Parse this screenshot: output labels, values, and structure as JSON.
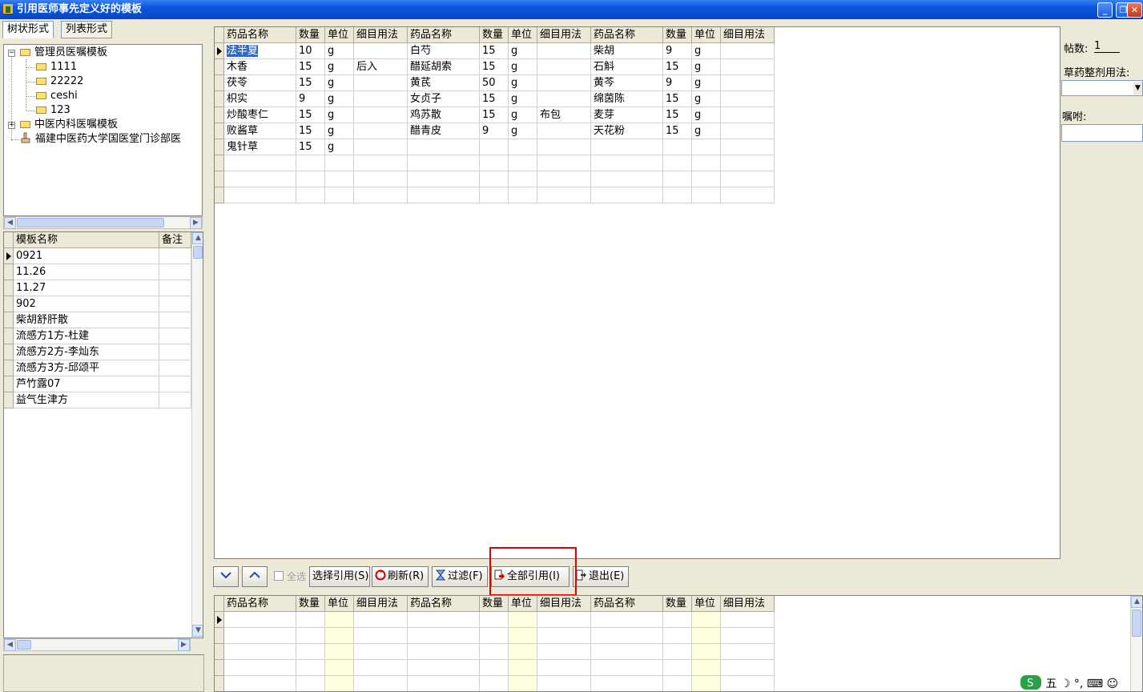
{
  "window": {
    "title": "引用医师事先定义好的模板",
    "min": "_",
    "restore": "❐",
    "close": "✕"
  },
  "tabs": [
    "树状形式",
    "列表形式"
  ],
  "tree": {
    "nodes": [
      {
        "label": "管理员医嘱模板",
        "expanded": true,
        "children": [
          "1111",
          "22222",
          "ceshi",
          "123"
        ]
      },
      {
        "label": "中医内科医嘱模板",
        "expanded": false
      },
      {
        "label": "福建中医药大学国医堂门诊部医"
      }
    ]
  },
  "template_list": {
    "headers": [
      "模板名称",
      "备注"
    ],
    "rows": [
      "0921",
      "11.26",
      "11.27",
      "902",
      "柴胡舒肝散",
      "流感方1方-杜建",
      "流感方2方-李灿东",
      "流感方3方-邱颂平",
      "芦竹露07",
      "益气生津方"
    ]
  },
  "prescription": {
    "headers": [
      "药品名称",
      "数量",
      "单位",
      "细目用法",
      "药品名称",
      "数量",
      "单位",
      "细目用法",
      "药品名称",
      "数量",
      "单位",
      "细目用法"
    ],
    "rows": [
      [
        "法半夏",
        "10",
        "g",
        "",
        "白芍",
        "15",
        "g",
        "",
        "柴胡",
        "9",
        "g",
        ""
      ],
      [
        "木香",
        "15",
        "g",
        "后入",
        "醋延胡索",
        "15",
        "g",
        "",
        "石斛",
        "15",
        "g",
        ""
      ],
      [
        "茯苓",
        "15",
        "g",
        "",
        "黄芪",
        "50",
        "g",
        "",
        "黄芩",
        "9",
        "g",
        ""
      ],
      [
        "枳实",
        "9",
        "g",
        "",
        "女贞子",
        "15",
        "g",
        "",
        "绵茵陈",
        "15",
        "g",
        ""
      ],
      [
        "炒酸枣仁",
        "15",
        "g",
        "",
        "鸡苏散",
        "15",
        "g",
        "布包",
        "麦芽",
        "15",
        "g",
        ""
      ],
      [
        "败酱草",
        "15",
        "g",
        "",
        "醋青皮",
        "9",
        "g",
        "",
        "天花粉",
        "15",
        "g",
        ""
      ],
      [
        "鬼针草",
        "15",
        "g",
        "",
        "",
        "",
        "",
        "",
        "",
        "",
        "",
        ""
      ]
    ]
  },
  "toolbar": {
    "select_all": "全选",
    "select_ref": "选择引用(S)",
    "refresh": "刷新(R)",
    "filter": "过滤(F)",
    "ref_all": "全部引用(I)",
    "exit": "退出(E)"
  },
  "right_panel": {
    "tie_label": "帖数:",
    "tie_value": "1",
    "decoction_label": "草药整剂用法:",
    "advice_label": "嘱咐:"
  },
  "ime": {
    "mode": "五"
  },
  "colors": {
    "title_bar": "#0a54de",
    "selection": "#316ac5",
    "highlight_box": "#e00000",
    "unit_col": "#ffffe1"
  }
}
